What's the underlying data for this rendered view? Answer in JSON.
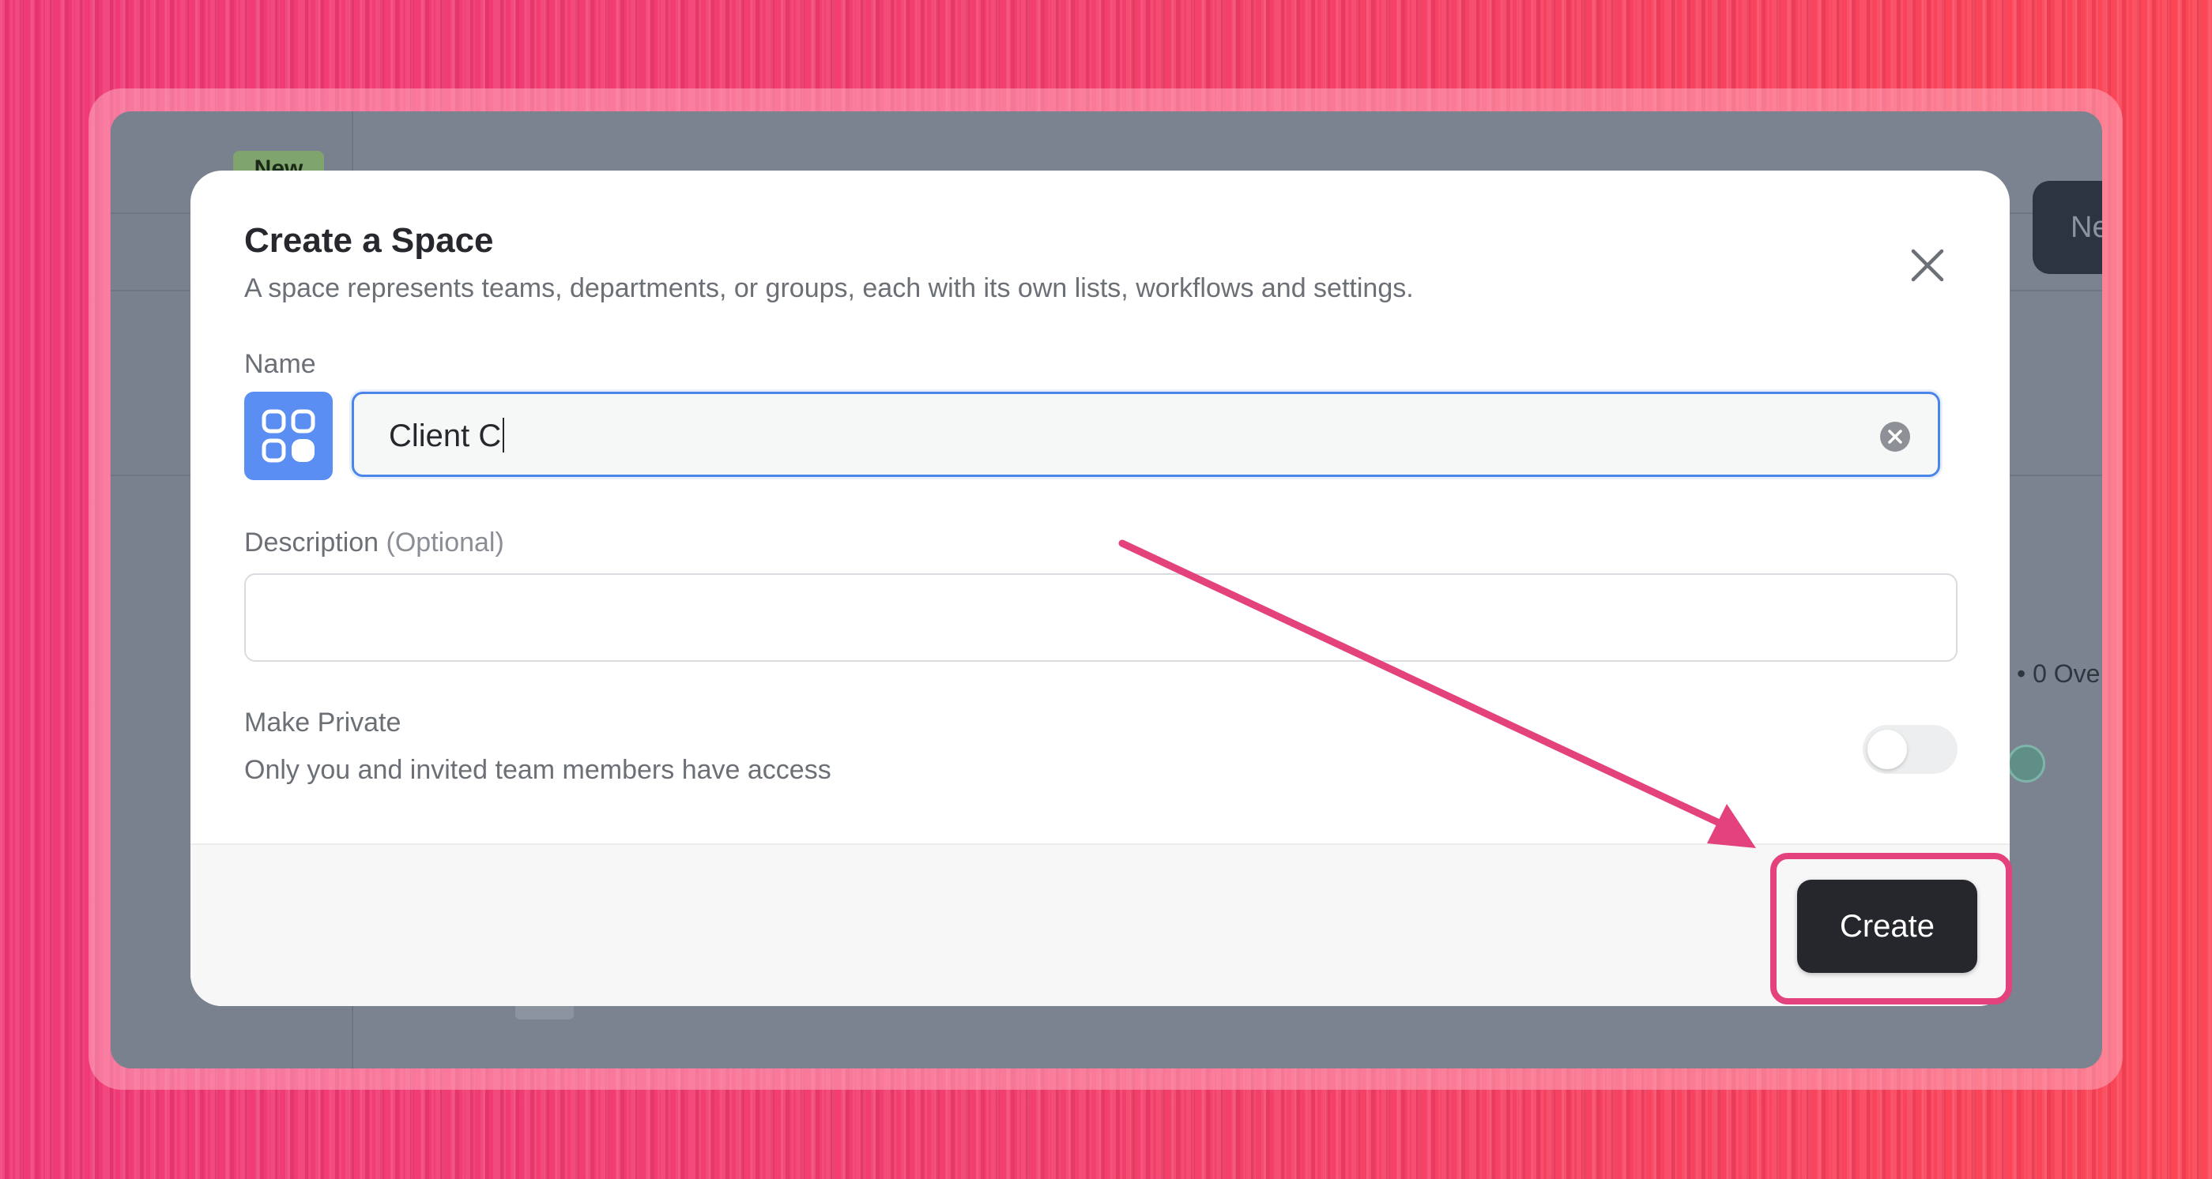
{
  "background_app": {
    "new_badge": "New",
    "new_button_fragment": "Ne",
    "overdue_fragment": "• 0 Ove"
  },
  "modal": {
    "title": "Create a Space",
    "subtitle": "A space represents teams, departments, or groups, each with its own lists, workflows and settings.",
    "name_label": "Name",
    "name_value": "Client C",
    "description_label": "Description",
    "description_optional": "(Optional)",
    "description_value": "",
    "private_title": "Make Private",
    "private_subtitle": "Only you and invited team members have access",
    "private_enabled": false,
    "create_label": "Create"
  },
  "icons": {
    "close": "close-icon",
    "space": "space-grid-icon",
    "clear": "clear-input-icon"
  },
  "colors": {
    "accent_blue": "#5b8ef2",
    "annotation_pink": "#e4427d",
    "create_button": "#25272c"
  }
}
